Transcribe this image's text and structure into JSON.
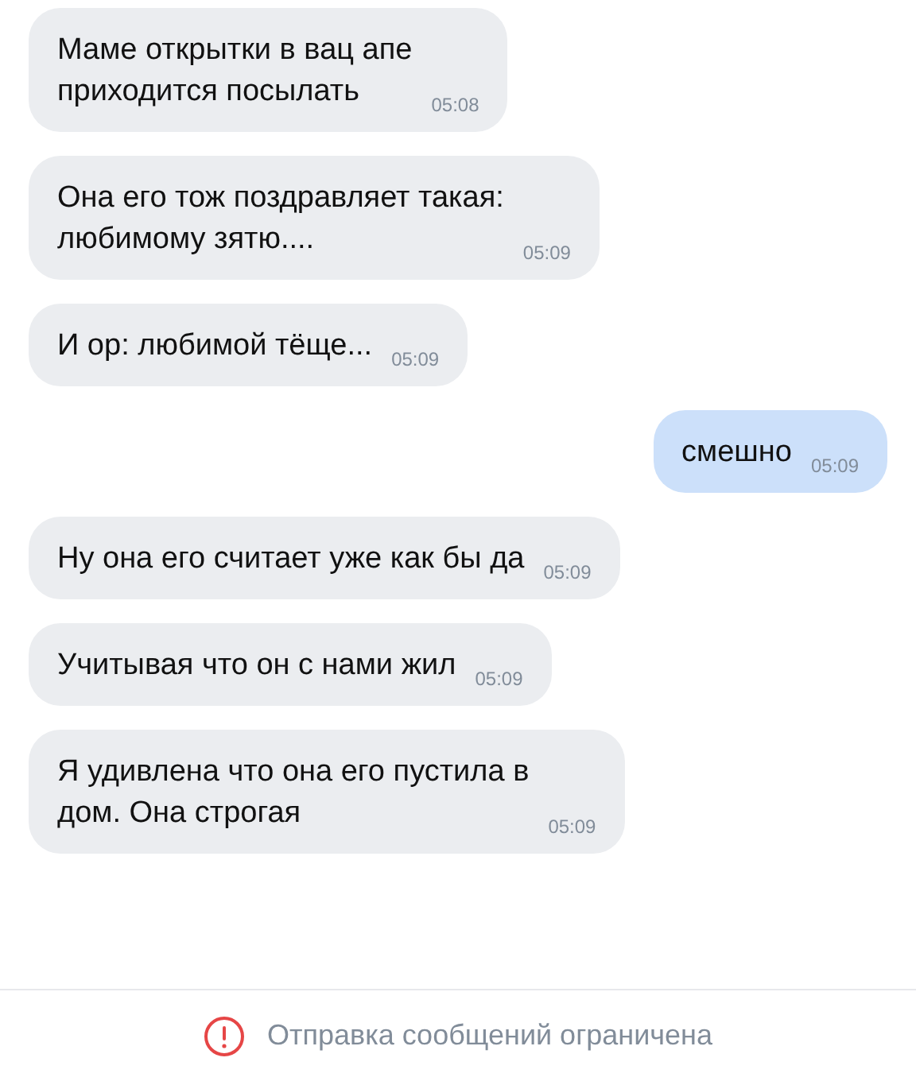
{
  "messages": [
    {
      "kind": "incoming",
      "lines": [
        "Маме открытки в вац апе",
        "приходится посылать"
      ],
      "time": "05:08"
    },
    {
      "kind": "incoming",
      "lines": [
        "Она его тож поздравляет такая:",
        "любимому зятю...."
      ],
      "time": "05:09"
    },
    {
      "kind": "incoming",
      "lines": [
        "И ор: любимой тёще..."
      ],
      "time": "05:09"
    },
    {
      "kind": "outgoing",
      "lines": [
        "смешно"
      ],
      "time": "05:09"
    },
    {
      "kind": "incoming",
      "lines": [
        "Ну она его считает уже как бы да"
      ],
      "time": "05:09"
    },
    {
      "kind": "incoming",
      "lines": [
        "Учитывая что он с нами жил"
      ],
      "time": "05:09"
    },
    {
      "kind": "incoming",
      "lines": [
        "Я удивлена что она его пустила в",
        "дом. Она строгая"
      ],
      "time": "05:09"
    }
  ],
  "footer": {
    "notice": "Отправка сообщений ограничена"
  }
}
